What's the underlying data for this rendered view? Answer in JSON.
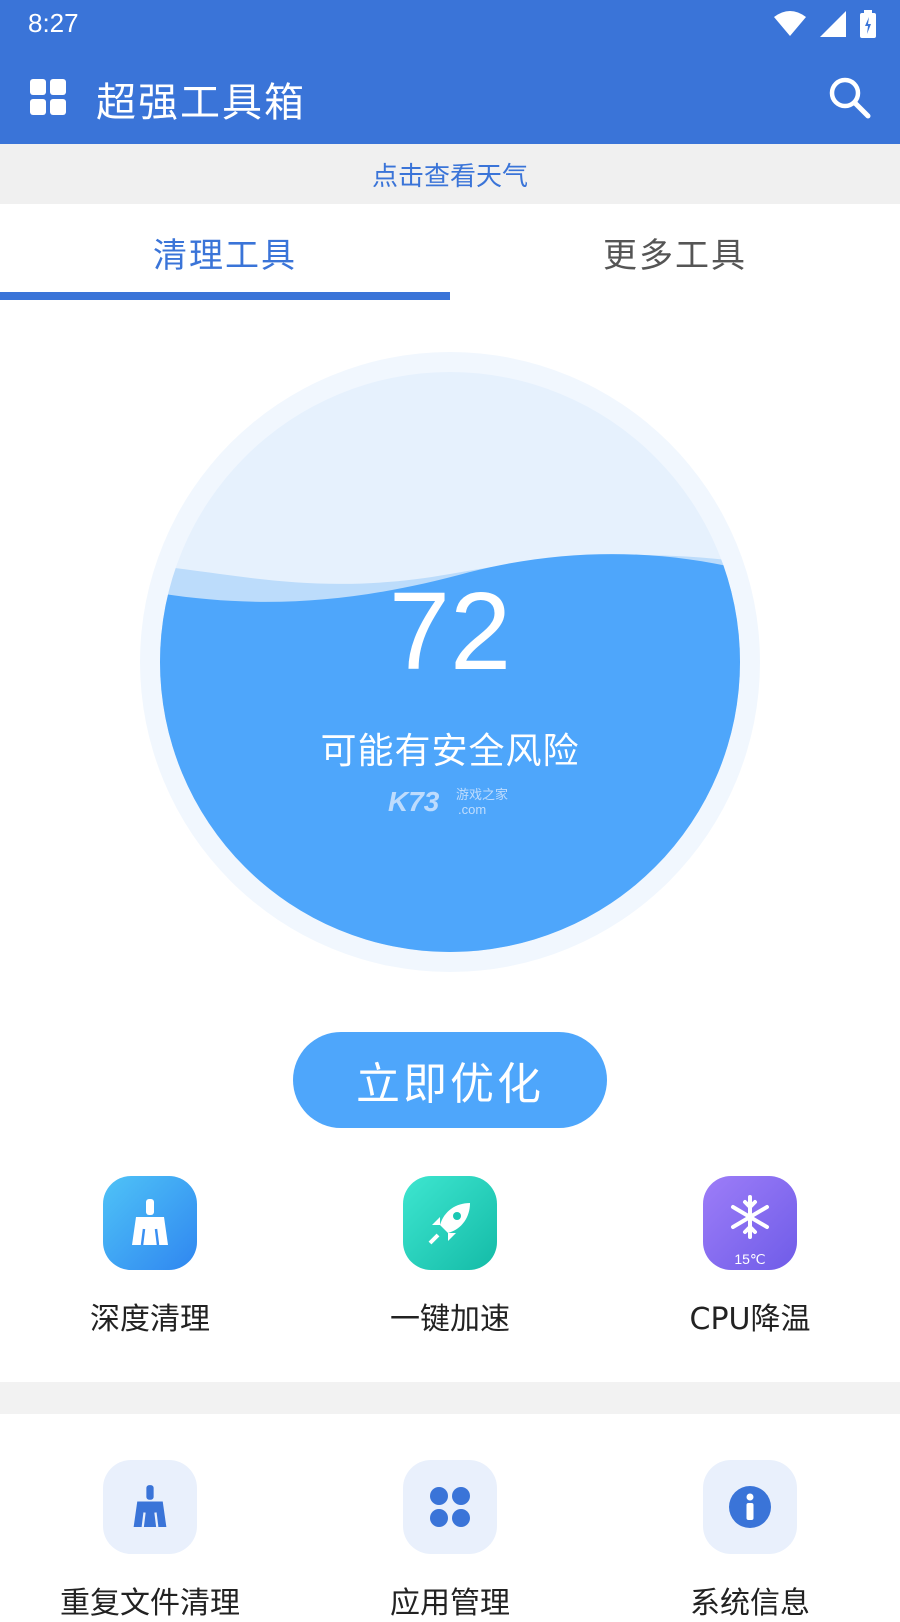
{
  "status_bar": {
    "time": "8:27"
  },
  "app_bar": {
    "title": "超强工具箱"
  },
  "weather_bar": {
    "text": "点击查看天气"
  },
  "tabs": [
    {
      "label": "清理工具",
      "active": true
    },
    {
      "label": "更多工具",
      "active": false
    }
  ],
  "gauge": {
    "score": "72",
    "status": "可能有安全风险",
    "watermark": "K73 游戏之家 .com"
  },
  "optimize_button": {
    "label": "立即优化"
  },
  "primary_tools": [
    {
      "label": "深度清理",
      "icon": "broom-icon"
    },
    {
      "label": "一键加速",
      "icon": "rocket-icon"
    },
    {
      "label": "CPU降温",
      "icon": "snowflake-icon",
      "badge": "15℃"
    }
  ],
  "secondary_tools": [
    {
      "label": "重复文件清理",
      "icon": "broom-icon"
    },
    {
      "label": "应用管理",
      "icon": "apps-icon"
    },
    {
      "label": "系统信息",
      "icon": "info-icon"
    }
  ],
  "colors": {
    "primary": "#3a74d8",
    "gauge_water": "#4ea6fb",
    "button": "#4ea6fb"
  }
}
